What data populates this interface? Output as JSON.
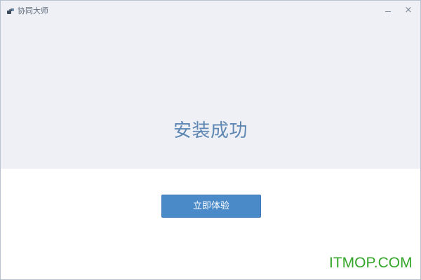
{
  "window": {
    "title": "协同大师"
  },
  "controls": {
    "minimize_icon": "minimize-icon",
    "close_icon": "close-icon",
    "close_glyph": "×"
  },
  "main": {
    "headline": "安装成功",
    "button_label": "立即体验"
  },
  "watermark": {
    "text": "ITMOP.COM"
  },
  "colors": {
    "top_background": "#eef0f5",
    "headline": "#5d86b2",
    "button": "#4a8ac8",
    "watermark": "#33a528"
  }
}
